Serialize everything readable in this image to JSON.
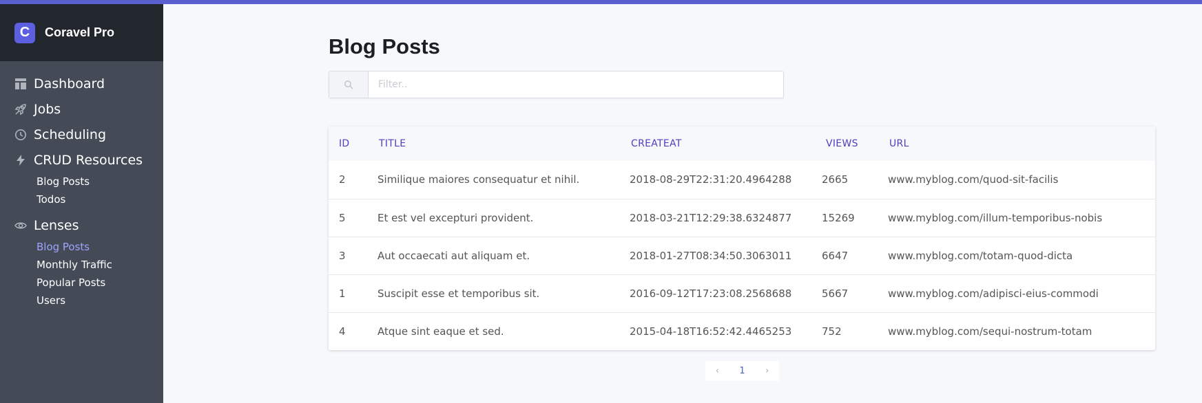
{
  "app": {
    "name": "Coravel Pro",
    "logo_letter": "C",
    "accent": "#5c5fe0"
  },
  "sidebar": {
    "items": [
      {
        "label": "Dashboard",
        "icon": "dashboard-icon"
      },
      {
        "label": "Jobs",
        "icon": "rocket-icon"
      },
      {
        "label": "Scheduling",
        "icon": "clock-icon"
      },
      {
        "label": "CRUD Resources",
        "icon": "bolt-icon"
      },
      {
        "label": "Lenses",
        "icon": "eye-icon"
      }
    ],
    "crud_sub": [
      "Blog Posts",
      "Todos"
    ],
    "lenses_sub": [
      "Blog Posts",
      "Monthly Traffic",
      "Popular Posts",
      "Users"
    ],
    "active": "Lenses / Blog Posts"
  },
  "page": {
    "title": "Blog Posts",
    "filter_placeholder": "Filter..",
    "filter_value": ""
  },
  "table": {
    "columns": [
      "ID",
      "TITLE",
      "CREATEAT",
      "VIEWS",
      "URL"
    ],
    "rows": [
      {
        "id": "2",
        "title": "Similique maiores consequatur et nihil.",
        "created": "2018-08-29T22:31:20.4964288",
        "views": "2665",
        "url": "www.myblog.com/quod-sit-facilis"
      },
      {
        "id": "5",
        "title": "Et est vel excepturi provident.",
        "created": "2018-03-21T12:29:38.6324877",
        "views": "15269",
        "url": "www.myblog.com/illum-temporibus-nobis"
      },
      {
        "id": "3",
        "title": "Aut occaecati aut aliquam et.",
        "created": "2018-01-27T08:34:50.3063011",
        "views": "6647",
        "url": "www.myblog.com/totam-quod-dicta"
      },
      {
        "id": "1",
        "title": "Suscipit esse et temporibus sit.",
        "created": "2016-09-12T17:23:08.2568688",
        "views": "5667",
        "url": "www.myblog.com/adipisci-eius-commodi"
      },
      {
        "id": "4",
        "title": "Atque sint eaque et sed.",
        "created": "2015-04-18T16:52:42.4465253",
        "views": "752",
        "url": "www.myblog.com/sequi-nostrum-totam"
      }
    ]
  },
  "pagination": {
    "prev": "‹",
    "current": "1",
    "next": "›"
  }
}
